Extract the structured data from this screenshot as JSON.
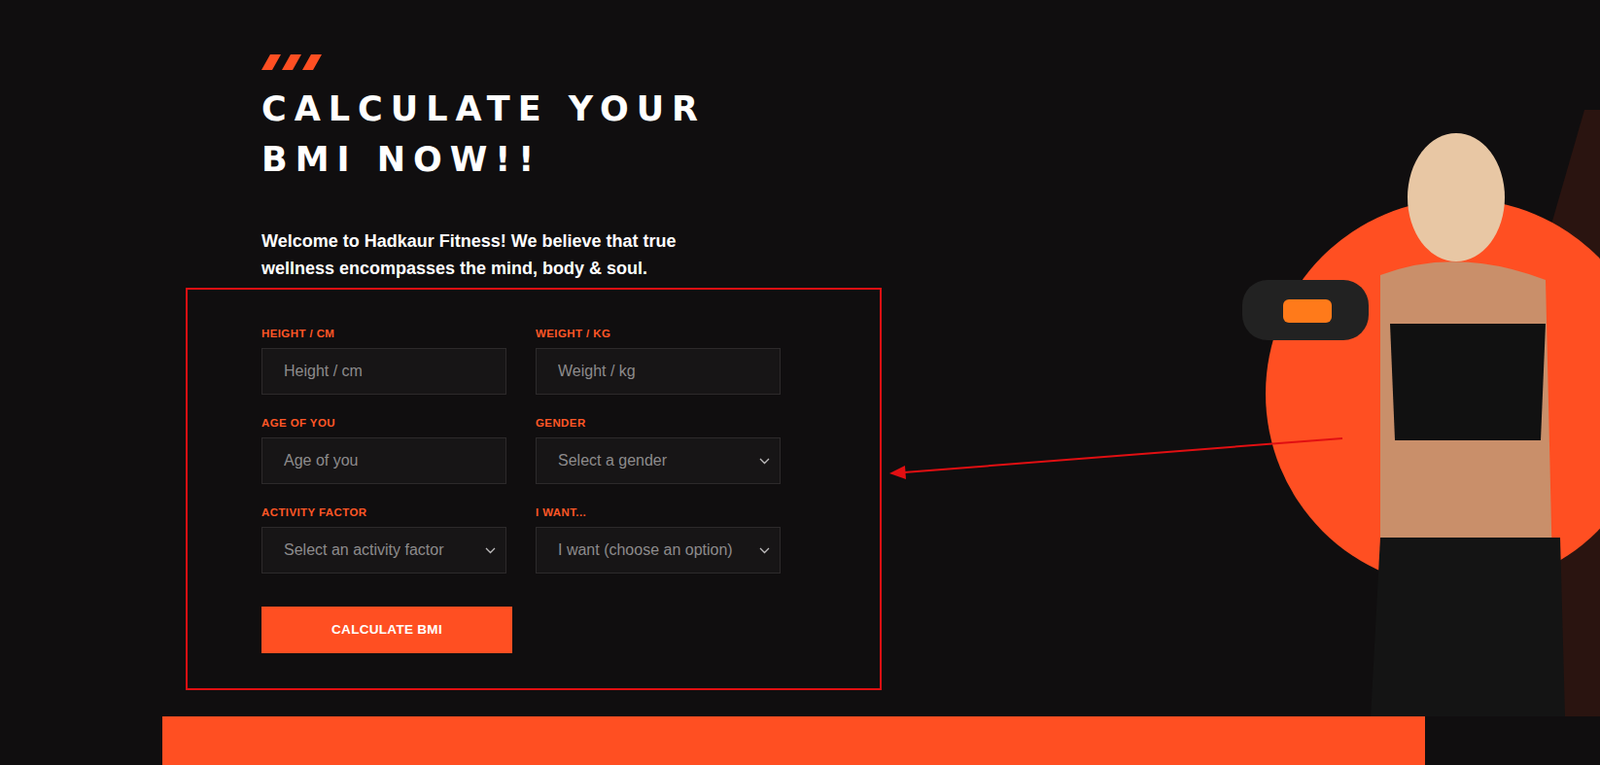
{
  "hero": {
    "heading": "CALCULATE YOUR BMI NOW!!",
    "intro": "Welcome to Hadkaur Fitness! We believe that true wellness encompasses the mind, body & soul."
  },
  "form": {
    "fields": [
      {
        "label": "HEIGHT / CM",
        "kind": "input",
        "placeholder": "Height / cm"
      },
      {
        "label": "WEIGHT / KG",
        "kind": "input",
        "placeholder": "Weight / kg"
      },
      {
        "label": "AGE OF YOU",
        "kind": "input",
        "placeholder": "Age of you"
      },
      {
        "label": "GENDER",
        "kind": "select",
        "placeholder": "Select a gender"
      },
      {
        "label": "ACTIVITY FACTOR",
        "kind": "select",
        "placeholder": "Select an activity factor"
      },
      {
        "label": "I WANT...",
        "kind": "select",
        "placeholder": "I want (choose an option)"
      }
    ],
    "submit": "CALCULATE BMI"
  }
}
